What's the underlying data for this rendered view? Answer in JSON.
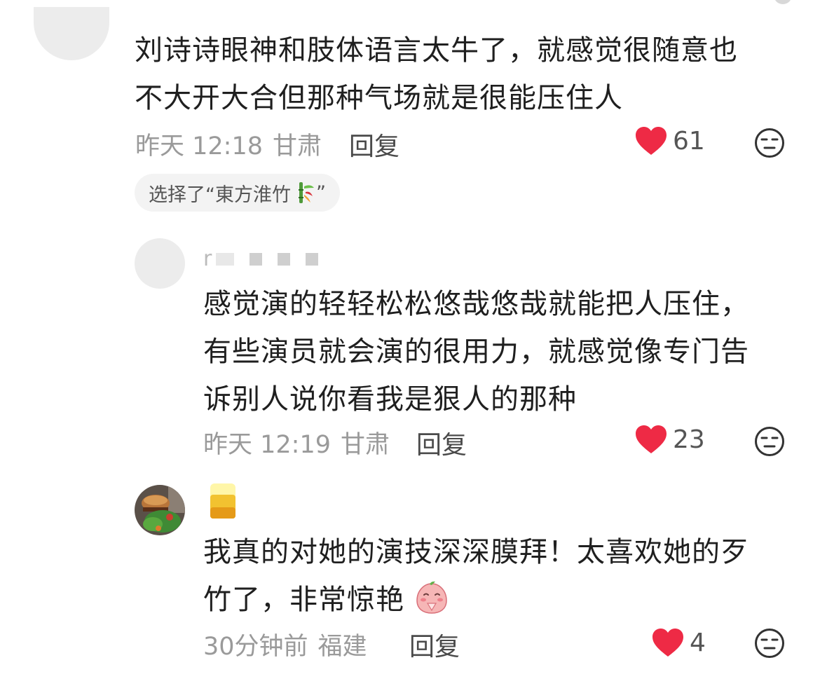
{
  "comments": [
    {
      "text_line1": "刘诗诗眼神和肢体语言太牛了，就感觉很随意也",
      "text_line2": "不大开大合但那种气场就是很能压住人",
      "time": "昨天 12:18",
      "location": "甘肃",
      "reply_label": "回复",
      "likes": "61",
      "choice": "选择了“東方淮竹",
      "choice_close": "”"
    },
    {
      "username_initial": "r",
      "text_line1": "感觉演的轻轻松松悠哉悠哉就能把人压住，",
      "text_line2": "有些演员就会演的很用力，就感觉像专门告",
      "text_line3": "诉别人说你看我是狠人的那种",
      "time": "昨天 12:19",
      "location": "甘肃",
      "reply_label": "回复",
      "likes": "23"
    },
    {
      "text_line1": "我真的对她的演技深深膜拜！太喜欢她的歹",
      "text_line2": "竹了，非常惊艳",
      "time": "30分钟前",
      "location": "福建",
      "reply_label": "回复",
      "likes": "4"
    }
  ],
  "colors": {
    "heart": "#ee2a45",
    "meta": "#9a9a9a",
    "text": "#1f1f1f",
    "chip_bg": "#f3f3f3"
  }
}
